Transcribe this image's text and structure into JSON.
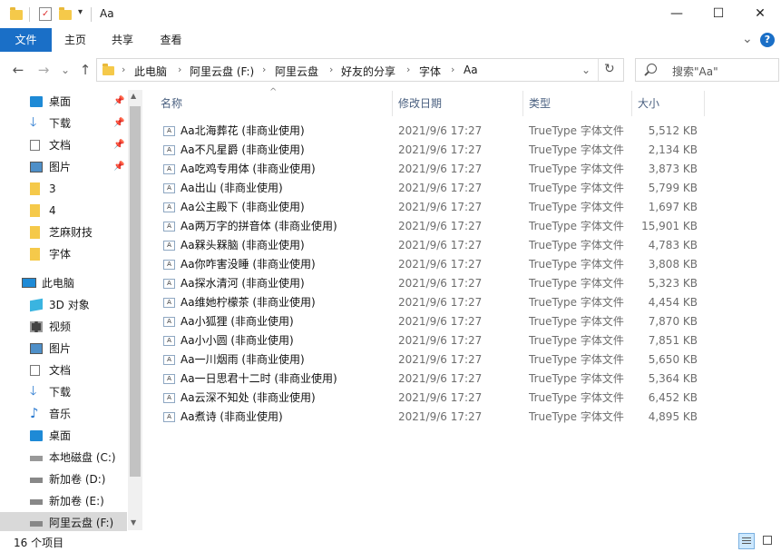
{
  "window": {
    "title": "Aa",
    "minimize_glyph": "—",
    "maximize_glyph": "☐",
    "close_glyph": "✕"
  },
  "ribbon": {
    "tabs": [
      "文件",
      "主页",
      "共享",
      "查看"
    ],
    "expand_glyph": "⌄",
    "help_glyph": "?"
  },
  "nav": {
    "back_glyph": "←",
    "forward_glyph": "→",
    "recent_glyph": "⌄",
    "up_glyph": "↑",
    "crumbs": [
      "此电脑",
      "阿里云盘 (F:)",
      "阿里云盘",
      "好友的分享",
      "字体",
      "Aa"
    ],
    "dropdown_glyph": "⌄",
    "refresh_glyph": "↻",
    "search_placeholder": "搜索\"Aa\""
  },
  "sidebar": {
    "quick": [
      {
        "label": "桌面",
        "icon": "desktop-icon",
        "pinned": true
      },
      {
        "label": "下载",
        "icon": "download-icon",
        "pinned": true
      },
      {
        "label": "文档",
        "icon": "document-icon",
        "pinned": true
      },
      {
        "label": "图片",
        "icon": "pictures-icon",
        "pinned": true
      },
      {
        "label": "3",
        "icon": "folder-icon",
        "pinned": false
      },
      {
        "label": "4",
        "icon": "folder-icon",
        "pinned": false
      },
      {
        "label": "芝麻财技",
        "icon": "folder-icon",
        "pinned": false
      },
      {
        "label": "字体",
        "icon": "folder-icon",
        "pinned": false
      }
    ],
    "thispc_label": "此电脑",
    "pc": [
      {
        "label": "3D 对象",
        "icon": "3d-objects-icon"
      },
      {
        "label": "视频",
        "icon": "video-icon"
      },
      {
        "label": "图片",
        "icon": "pictures-icon"
      },
      {
        "label": "文档",
        "icon": "document-icon"
      },
      {
        "label": "下载",
        "icon": "download-icon"
      },
      {
        "label": "音乐",
        "icon": "music-icon"
      },
      {
        "label": "桌面",
        "icon": "desktop-icon"
      },
      {
        "label": "本地磁盘 (C:)",
        "icon": "system-drive-icon"
      },
      {
        "label": "新加卷 (D:)",
        "icon": "drive-icon"
      },
      {
        "label": "新加卷 (E:)",
        "icon": "drive-icon"
      },
      {
        "label": "阿里云盘 (F:)",
        "icon": "drive-icon"
      }
    ]
  },
  "columns": {
    "name": "名称",
    "date": "修改日期",
    "type": "类型",
    "size": "大小",
    "sort_glyph": "^"
  },
  "files": [
    {
      "name": "Aa北海葬花 (非商业使用)",
      "date": "2021/9/6 17:27",
      "type": "TrueType 字体文件",
      "size": "5,512 KB"
    },
    {
      "name": "Aa不凡星爵 (非商业使用)",
      "date": "2021/9/6 17:27",
      "type": "TrueType 字体文件",
      "size": "2,134 KB"
    },
    {
      "name": "Aa吃鸡专用体 (非商业使用)",
      "date": "2021/9/6 17:27",
      "type": "TrueType 字体文件",
      "size": "3,873 KB"
    },
    {
      "name": "Aa出山 (非商业使用)",
      "date": "2021/9/6 17:27",
      "type": "TrueType 字体文件",
      "size": "5,799 KB"
    },
    {
      "name": "Aa公主殿下 (非商业使用)",
      "date": "2021/9/6 17:27",
      "type": "TrueType 字体文件",
      "size": "1,697 KB"
    },
    {
      "name": "Aa两万字的拼音体 (非商业使用)",
      "date": "2021/9/6 17:27",
      "type": "TrueType 字体文件",
      "size": "15,901 KB"
    },
    {
      "name": "Aa槑头槑脑 (非商业使用)",
      "date": "2021/9/6 17:27",
      "type": "TrueType 字体文件",
      "size": "4,783 KB"
    },
    {
      "name": "Aa你咋害没睡 (非商业使用)",
      "date": "2021/9/6 17:27",
      "type": "TrueType 字体文件",
      "size": "3,808 KB"
    },
    {
      "name": "Aa探水清河 (非商业使用)",
      "date": "2021/9/6 17:27",
      "type": "TrueType 字体文件",
      "size": "5,323 KB"
    },
    {
      "name": "Aa维她柠檬茶 (非商业使用)",
      "date": "2021/9/6 17:27",
      "type": "TrueType 字体文件",
      "size": "4,454 KB"
    },
    {
      "name": "Aa小狐狸 (非商业使用)",
      "date": "2021/9/6 17:27",
      "type": "TrueType 字体文件",
      "size": "7,870 KB"
    },
    {
      "name": "Aa小小圆 (非商业使用)",
      "date": "2021/9/6 17:27",
      "type": "TrueType 字体文件",
      "size": "7,851 KB"
    },
    {
      "name": "Aa一川烟雨 (非商业使用)",
      "date": "2021/9/6 17:27",
      "type": "TrueType 字体文件",
      "size": "5,650 KB"
    },
    {
      "name": "Aa一日思君十二时 (非商业使用)",
      "date": "2021/9/6 17:27",
      "type": "TrueType 字体文件",
      "size": "5,364 KB"
    },
    {
      "name": "Aa云深不知处 (非商业使用)",
      "date": "2021/9/6 17:27",
      "type": "TrueType 字体文件",
      "size": "6,452 KB"
    },
    {
      "name": "Aa煮诗 (非商业使用)",
      "date": "2021/9/6 17:27",
      "type": "TrueType 字体文件",
      "size": "4,895 KB"
    }
  ],
  "status": {
    "count": "16 个项目"
  },
  "colors": {
    "accent": "#1a6fc7",
    "folder": "#f5c94a",
    "selected_bg": "#cce8ff"
  }
}
